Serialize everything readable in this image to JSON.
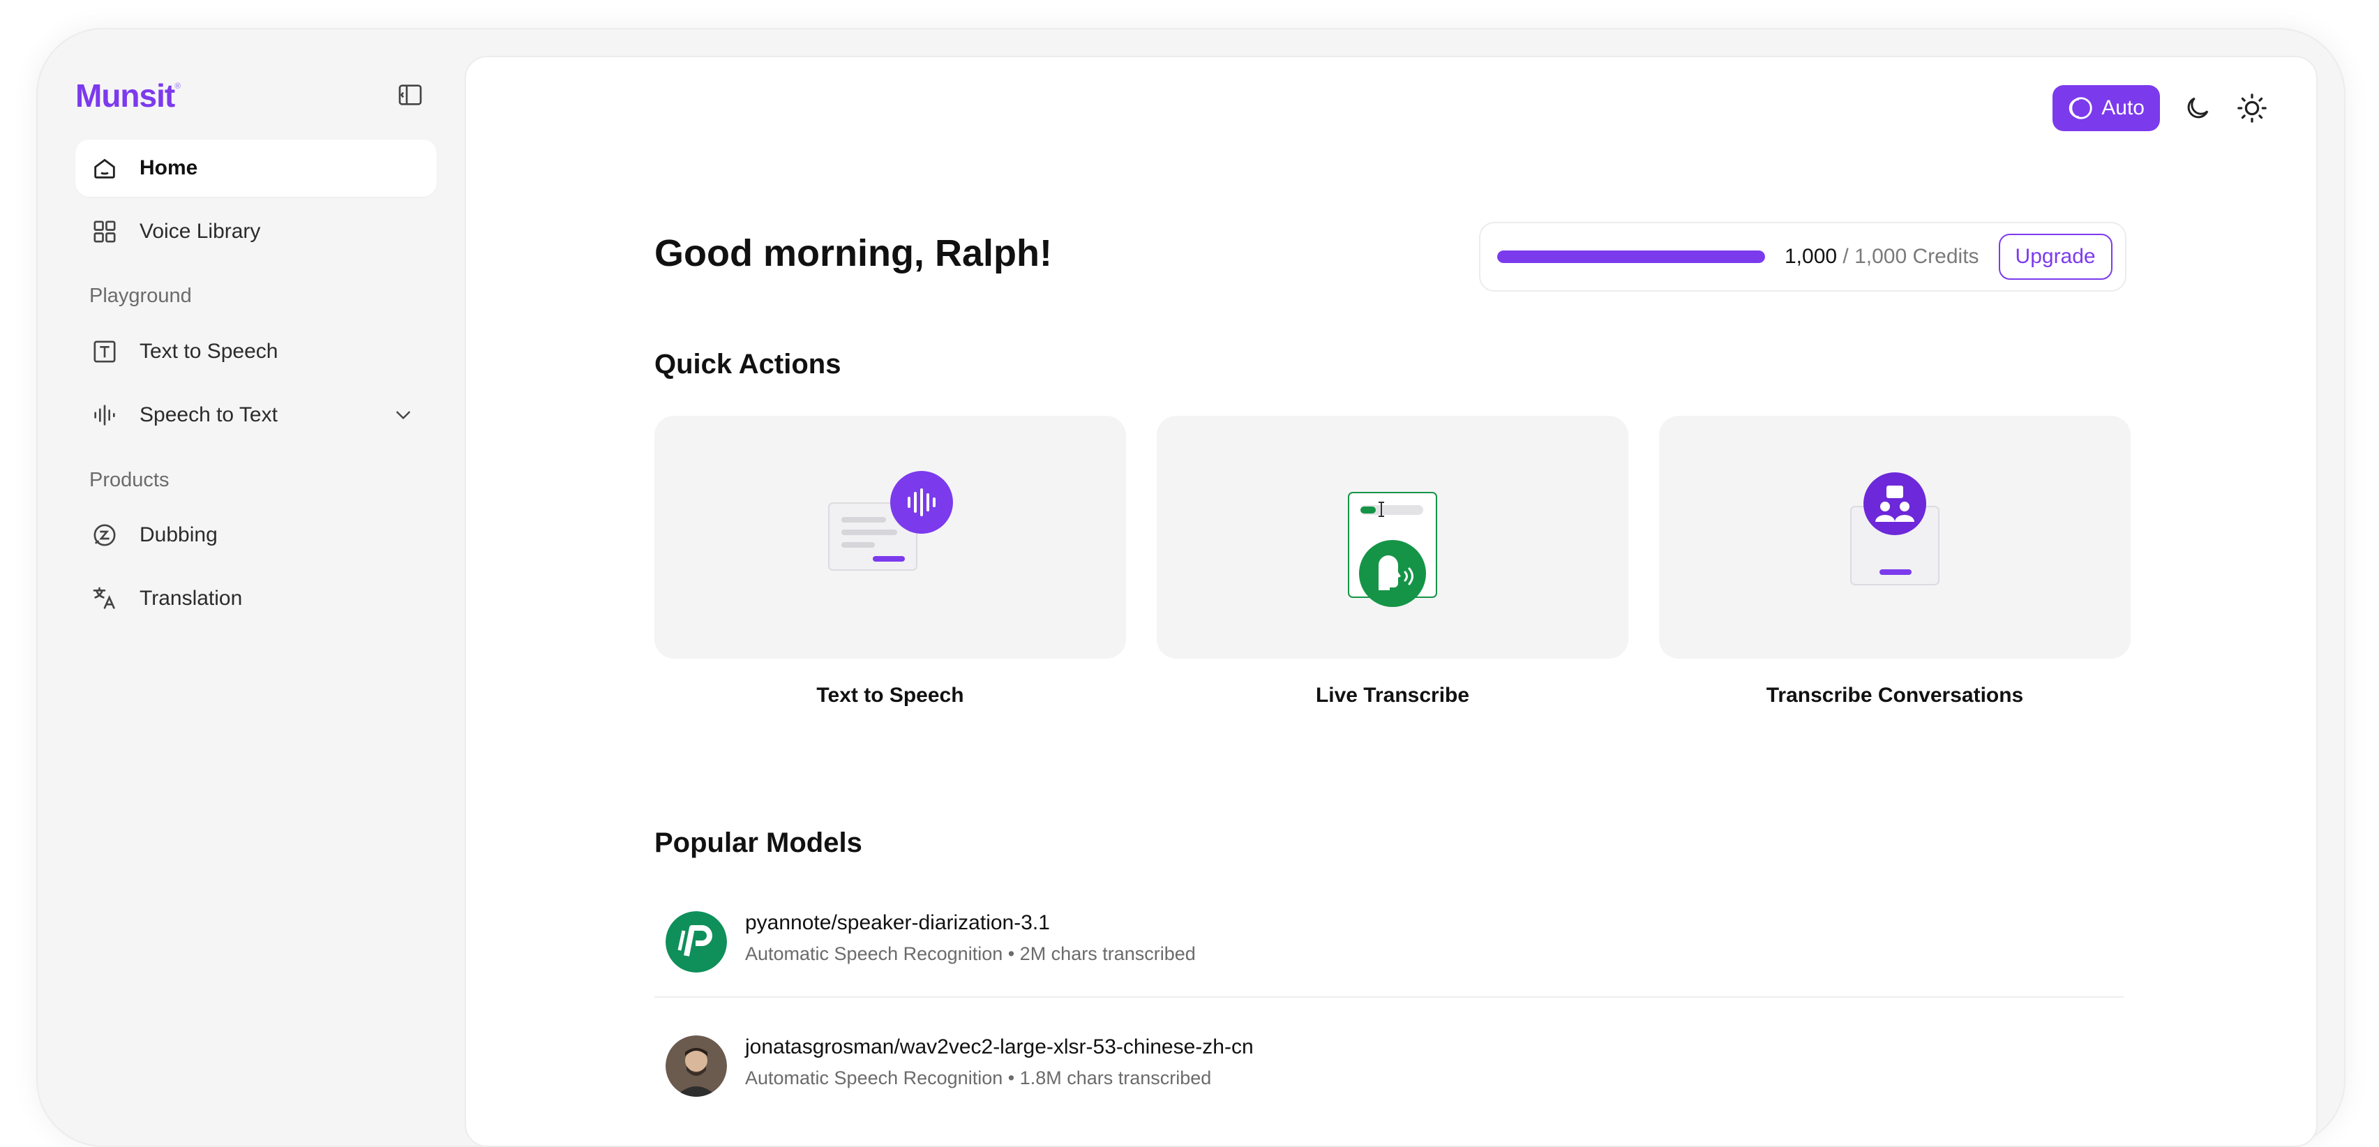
{
  "app": {
    "logo": "Munsit"
  },
  "sidebar": {
    "items": [
      {
        "label": "Home",
        "icon": "home-icon",
        "active": true
      },
      {
        "label": "Voice Library",
        "icon": "grid-icon"
      }
    ],
    "sections": [
      {
        "label": "Playground",
        "items": [
          {
            "label": "Text to Speech",
            "icon": "text-box-icon"
          },
          {
            "label": "Speech to Text",
            "icon": "waveform-icon",
            "expandable": true
          }
        ]
      },
      {
        "label": "Products",
        "items": [
          {
            "label": "Dubbing",
            "icon": "dubbing-icon"
          },
          {
            "label": "Translation",
            "icon": "translate-icon"
          }
        ]
      }
    ]
  },
  "header": {
    "theme_auto_label": "Auto"
  },
  "greeting": "Good morning, Ralph!",
  "credits": {
    "used": "1,000",
    "total_text": "/ 1,000 Credits",
    "progress": 1.0,
    "upgrade_label": "Upgrade"
  },
  "quick_actions": {
    "title": "Quick Actions",
    "cards": [
      {
        "label": "Text to Speech"
      },
      {
        "label": "Live Transcribe"
      },
      {
        "label": "Transcribe Conversations"
      }
    ]
  },
  "popular_models": {
    "title": "Popular Models",
    "items": [
      {
        "name": "pyannote/speaker-diarization-3.1",
        "meta": "Automatic Speech Recognition • 2M chars transcribed"
      },
      {
        "name": "jonatasgrosman/wav2vec2-large-xlsr-53-chinese-zh-cn",
        "meta": "Automatic Speech Recognition • 1.8M chars transcribed"
      }
    ]
  },
  "colors": {
    "accent": "#7c3aed",
    "green": "#159447"
  }
}
